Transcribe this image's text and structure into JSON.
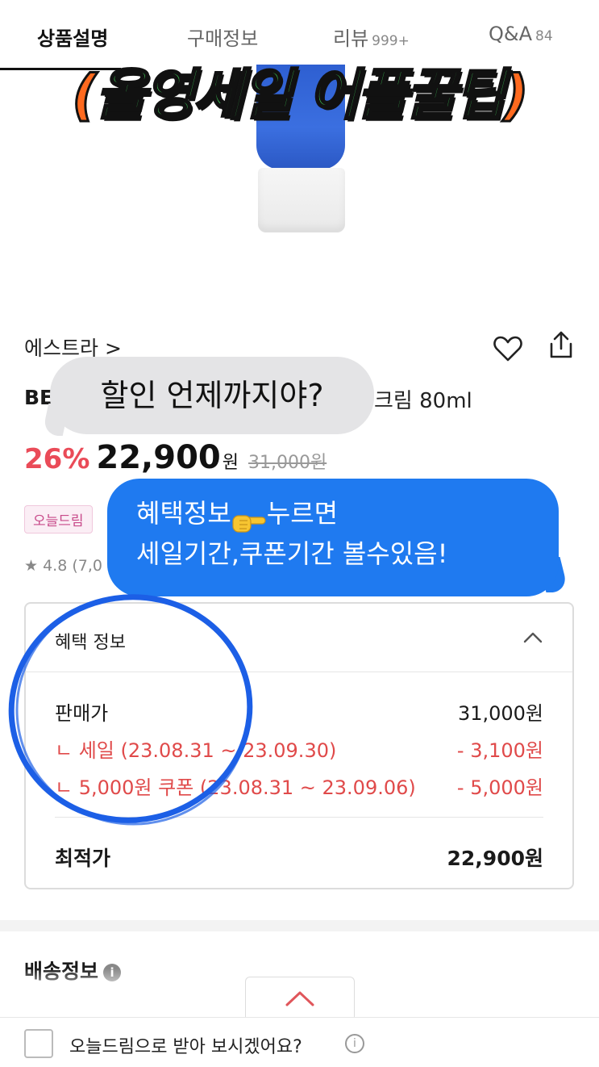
{
  "tabs": {
    "description": "상품설명",
    "purchase": "구매정보",
    "review": "리뷰",
    "review_count": "999+",
    "qa": "Q&A",
    "qa_count": "84"
  },
  "overlay": {
    "open": "(",
    "title": "올영세일 어플꿀팁",
    "close": ")"
  },
  "product": {
    "brand": "에스트라 >",
    "name_prefix": "BE",
    "name_suffix": "크림 80ml",
    "discount": "26%",
    "price": "22,900",
    "currency": "원",
    "original_price": "31,000원",
    "tag": "오늘드림",
    "rating": "★ 4.8 (7,0"
  },
  "bubbles": {
    "grey": "할인 언제까지야?",
    "blue_line1_a": "혜택정보",
    "blue_line1_b": "누르면",
    "blue_line2": "세일기간,쿠폰기간 볼수있음!"
  },
  "benefit": {
    "header": "혜택 정보",
    "rows": [
      {
        "label": "판매가",
        "value": "31,000원"
      },
      {
        "label": "ㄴ 세일 (23.08.31 ~ 23.09.30)",
        "value": "- 3,100원"
      },
      {
        "label": "ㄴ 5,000원 쿠폰 (23.08.31 ~ 23.09.06)",
        "value": "- 5,000원"
      }
    ],
    "total_label": "최적가",
    "total_value": "22,900원"
  },
  "delivery": {
    "title": "배송정보",
    "info": "i"
  },
  "bottom": {
    "checkbox_label": "오늘드림으로 받아 보시겠어요?",
    "info": "i"
  },
  "colors": {
    "discount_red": "#ea4b58",
    "blue_bubble": "#1f7af0",
    "grey_bubble": "#e4e4e6",
    "title_green": "#39b84f",
    "title_orange": "#ff6a1f"
  }
}
